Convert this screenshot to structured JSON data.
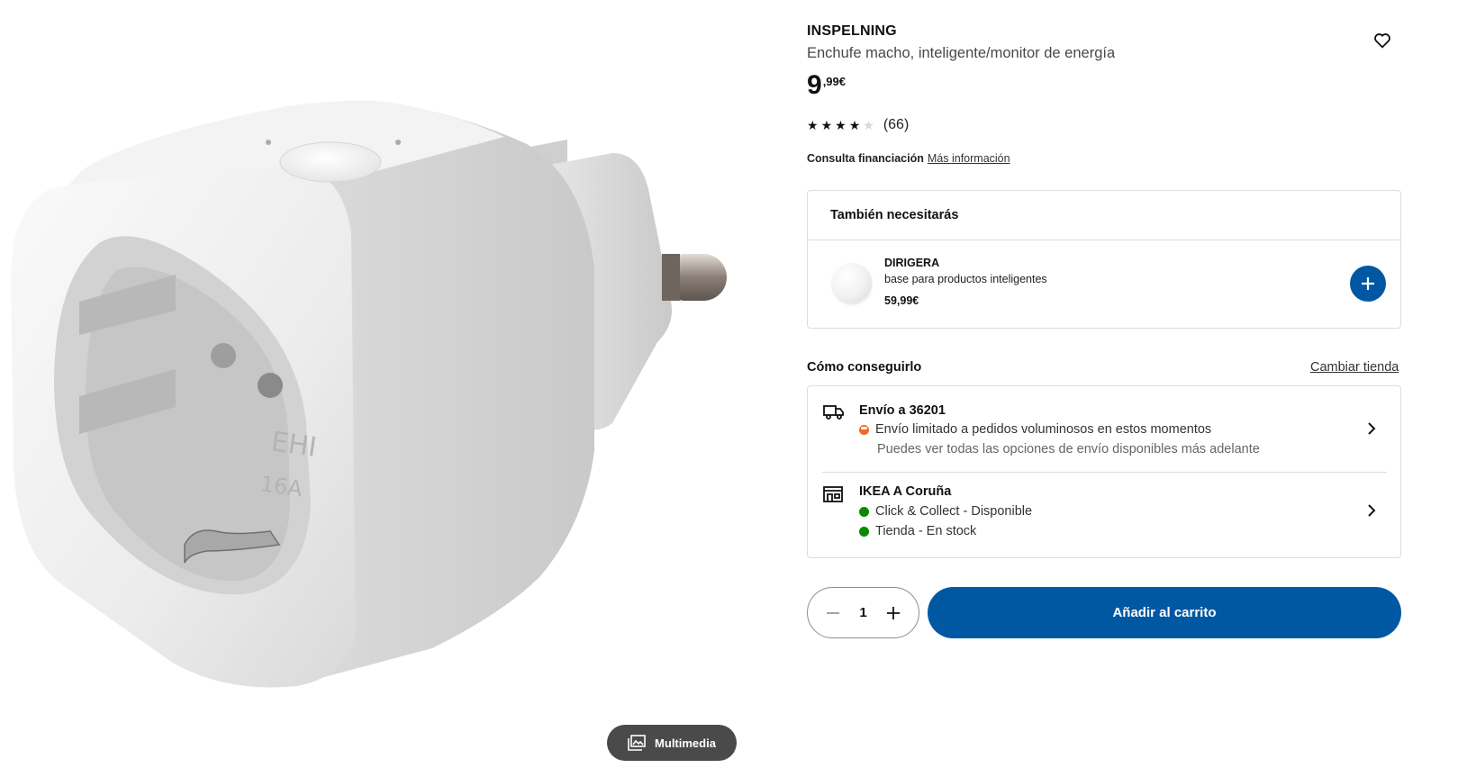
{
  "product": {
    "name": "INSPELNING",
    "description": "Enchufe macho, inteligente/monitor de energía",
    "price_integer": "9",
    "price_decimal": ",99€",
    "rating": {
      "value": 3.5,
      "max": 5,
      "count_label": "(66)"
    },
    "finance_label": "Consulta financiación",
    "finance_link": "Más información"
  },
  "gallery": {
    "media_button_label": "Multimedia",
    "image_embossed_text": [
      "EHI",
      "16A"
    ]
  },
  "also_need": {
    "title": "También necesitarás",
    "item": {
      "name": "DIRIGERA",
      "description": "base para productos inteligentes",
      "price": "59,99€"
    }
  },
  "how_to_get": {
    "title": "Cómo conseguirlo",
    "change_store_label": "Cambiar tienda",
    "delivery": {
      "title": "Envío a 36201",
      "status": "Envío limitado a pedidos voluminosos en estos momentos",
      "status_color": "#f26a21",
      "note": "Puedes ver todas las opciones de envío disponibles más adelante"
    },
    "store": {
      "title": "IKEA A Coruña",
      "lines": [
        {
          "text": "Click & Collect - Disponible",
          "color": "#0a8a00"
        },
        {
          "text": "Tienda - En stock",
          "color": "#0a8a00"
        }
      ]
    }
  },
  "purchase": {
    "quantity": "1",
    "add_to_cart_label": "Añadir al carrito"
  },
  "colors": {
    "brand_blue": "#0058a3",
    "media_button_bg": "#4a4a4a"
  }
}
